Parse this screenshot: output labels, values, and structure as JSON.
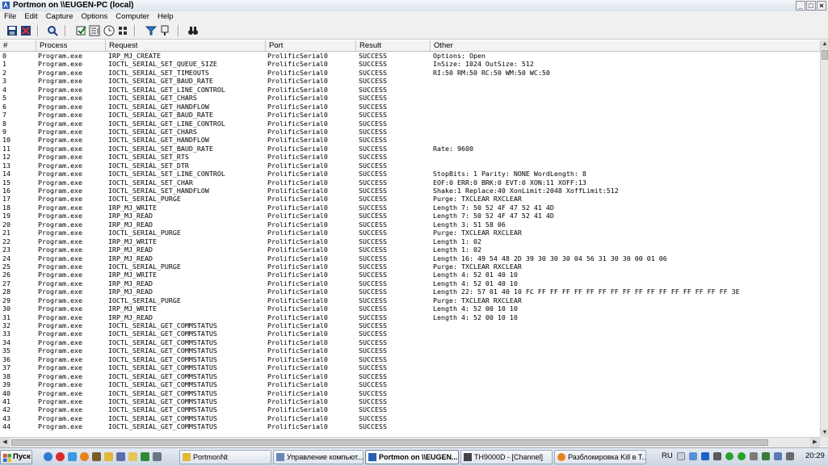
{
  "window": {
    "title": "Portmon on \\\\EUGEN-PC (local)"
  },
  "menu": [
    "File",
    "Edit",
    "Capture",
    "Options",
    "Computer",
    "Help"
  ],
  "columns": [
    "#",
    "Process",
    "Request",
    "Port",
    "Result",
    "Other"
  ],
  "rows": [
    [
      "0",
      "Program.exe",
      "IRP_MJ_CREATE",
      "ProlificSerial0",
      "SUCCESS",
      "Options: Open"
    ],
    [
      "1",
      "Program.exe",
      "IOCTL_SERIAL_SET_QUEUE_SIZE",
      "ProlificSerial0",
      "SUCCESS",
      "InSize: 1024 OutSize: 512"
    ],
    [
      "2",
      "Program.exe",
      "IOCTL_SERIAL_SET_TIMEOUTS",
      "ProlificSerial0",
      "SUCCESS",
      "RI:50 RM:50 RC:50 WM:50 WC:50"
    ],
    [
      "3",
      "Program.exe",
      "IOCTL_SERIAL_GET_BAUD_RATE",
      "ProlificSerial0",
      "SUCCESS",
      ""
    ],
    [
      "4",
      "Program.exe",
      "IOCTL_SERIAL_GET_LINE_CONTROL",
      "ProlificSerial0",
      "SUCCESS",
      ""
    ],
    [
      "5",
      "Program.exe",
      "IOCTL_SERIAL_GET_CHARS",
      "ProlificSerial0",
      "SUCCESS",
      ""
    ],
    [
      "6",
      "Program.exe",
      "IOCTL_SERIAL_GET_HANDFLOW",
      "ProlificSerial0",
      "SUCCESS",
      ""
    ],
    [
      "7",
      "Program.exe",
      "IOCTL_SERIAL_GET_BAUD_RATE",
      "ProlificSerial0",
      "SUCCESS",
      ""
    ],
    [
      "8",
      "Program.exe",
      "IOCTL_SERIAL_GET_LINE_CONTROL",
      "ProlificSerial0",
      "SUCCESS",
      ""
    ],
    [
      "9",
      "Program.exe",
      "IOCTL_SERIAL_GET_CHARS",
      "ProlificSerial0",
      "SUCCESS",
      ""
    ],
    [
      "10",
      "Program.exe",
      "IOCTL_SERIAL_GET_HANDFLOW",
      "ProlificSerial0",
      "SUCCESS",
      ""
    ],
    [
      "11",
      "Program.exe",
      "IOCTL_SERIAL_SET_BAUD_RATE",
      "ProlificSerial0",
      "SUCCESS",
      "Rate: 9600"
    ],
    [
      "12",
      "Program.exe",
      "IOCTL_SERIAL_SET_RTS",
      "ProlificSerial0",
      "SUCCESS",
      ""
    ],
    [
      "13",
      "Program.exe",
      "IOCTL_SERIAL_SET_DTR",
      "ProlificSerial0",
      "SUCCESS",
      ""
    ],
    [
      "14",
      "Program.exe",
      "IOCTL_SERIAL_SET_LINE_CONTROL",
      "ProlificSerial0",
      "SUCCESS",
      "StopBits: 1 Parity: NONE WordLength: 8"
    ],
    [
      "15",
      "Program.exe",
      "IOCTL_SERIAL_SET_CHAR",
      "ProlificSerial0",
      "SUCCESS",
      "EOF:0 ERR:0 BRK:0 EVT:0 XON:11 XOFF:13"
    ],
    [
      "16",
      "Program.exe",
      "IOCTL_SERIAL_SET_HANDFLOW",
      "ProlificSerial0",
      "SUCCESS",
      "Shake:1 Replace:40 XonLimit:2048 XoffLimit:512"
    ],
    [
      "17",
      "Program.exe",
      "IOCTL_SERIAL_PURGE",
      "ProlificSerial0",
      "SUCCESS",
      "Purge: TXCLEAR RXCLEAR"
    ],
    [
      "18",
      "Program.exe",
      "IRP_MJ_WRITE",
      "ProlificSerial0",
      "SUCCESS",
      "Length 7: 50 52 4F 47 52 41 4D"
    ],
    [
      "19",
      "Program.exe",
      "IRP_MJ_READ",
      "ProlificSerial0",
      "SUCCESS",
      "Length 7: 50 52 4F 47 52 41 4D"
    ],
    [
      "20",
      "Program.exe",
      "IRP_MJ_READ",
      "ProlificSerial0",
      "SUCCESS",
      "Length 3: 51 58 06"
    ],
    [
      "21",
      "Program.exe",
      "IOCTL_SERIAL_PURGE",
      "ProlificSerial0",
      "SUCCESS",
      "Purge: TXCLEAR RXCLEAR"
    ],
    [
      "22",
      "Program.exe",
      "IRP_MJ_WRITE",
      "ProlificSerial0",
      "SUCCESS",
      "Length 1: 02"
    ],
    [
      "23",
      "Program.exe",
      "IRP_MJ_READ",
      "ProlificSerial0",
      "SUCCESS",
      "Length 1: 02"
    ],
    [
      "24",
      "Program.exe",
      "IRP_MJ_READ",
      "ProlificSerial0",
      "SUCCESS",
      "Length 16: 49 54 48 2D 39 30 30 30 04 56 31 30 30 00 01 06"
    ],
    [
      "25",
      "Program.exe",
      "IOCTL_SERIAL_PURGE",
      "ProlificSerial0",
      "SUCCESS",
      "Purge: TXCLEAR RXCLEAR"
    ],
    [
      "26",
      "Program.exe",
      "IRP_MJ_WRITE",
      "ProlificSerial0",
      "SUCCESS",
      "Length 4: 52 01 40 10"
    ],
    [
      "27",
      "Program.exe",
      "IRP_MJ_READ",
      "ProlificSerial0",
      "SUCCESS",
      "Length 4: 52 01 40 10"
    ],
    [
      "28",
      "Program.exe",
      "IRP_MJ_READ",
      "ProlificSerial0",
      "SUCCESS",
      "Length 22: 57 01 40 10 FC FF FF FF FF FF FF FF FF FF FF FF FF FF FF FF FF 3E"
    ],
    [
      "29",
      "Program.exe",
      "IOCTL_SERIAL_PURGE",
      "ProlificSerial0",
      "SUCCESS",
      "Purge: TXCLEAR RXCLEAR"
    ],
    [
      "30",
      "Program.exe",
      "IRP_MJ_WRITE",
      "ProlificSerial0",
      "SUCCESS",
      "Length 4: 52 00 10 10"
    ],
    [
      "31",
      "Program.exe",
      "IRP_MJ_READ",
      "ProlificSerial0",
      "SUCCESS",
      "Length 4: 52 00 10 10"
    ],
    [
      "32",
      "Program.exe",
      "IOCTL_SERIAL_GET_COMMSTATUS",
      "ProlificSerial0",
      "SUCCESS",
      ""
    ],
    [
      "33",
      "Program.exe",
      "IOCTL_SERIAL_GET_COMMSTATUS",
      "ProlificSerial0",
      "SUCCESS",
      ""
    ],
    [
      "34",
      "Program.exe",
      "IOCTL_SERIAL_GET_COMMSTATUS",
      "ProlificSerial0",
      "SUCCESS",
      ""
    ],
    [
      "35",
      "Program.exe",
      "IOCTL_SERIAL_GET_COMMSTATUS",
      "ProlificSerial0",
      "SUCCESS",
      ""
    ],
    [
      "36",
      "Program.exe",
      "IOCTL_SERIAL_GET_COMMSTATUS",
      "ProlificSerial0",
      "SUCCESS",
      ""
    ],
    [
      "37",
      "Program.exe",
      "IOCTL_SERIAL_GET_COMMSTATUS",
      "ProlificSerial0",
      "SUCCESS",
      ""
    ],
    [
      "38",
      "Program.exe",
      "IOCTL_SERIAL_GET_COMMSTATUS",
      "ProlificSerial0",
      "SUCCESS",
      ""
    ],
    [
      "39",
      "Program.exe",
      "IOCTL_SERIAL_GET_COMMSTATUS",
      "ProlificSerial0",
      "SUCCESS",
      ""
    ],
    [
      "40",
      "Program.exe",
      "IOCTL_SERIAL_GET_COMMSTATUS",
      "ProlificSerial0",
      "SUCCESS",
      ""
    ],
    [
      "41",
      "Program.exe",
      "IOCTL_SERIAL_GET_COMMSTATUS",
      "ProlificSerial0",
      "SUCCESS",
      ""
    ],
    [
      "42",
      "Program.exe",
      "IOCTL_SERIAL_GET_COMMSTATUS",
      "ProlificSerial0",
      "SUCCESS",
      ""
    ],
    [
      "43",
      "Program.exe",
      "IOCTL_SERIAL_GET_COMMSTATUS",
      "ProlificSerial0",
      "SUCCESS",
      ""
    ],
    [
      "44",
      "Program.exe",
      "IOCTL_SERIAL_GET_COMMSTATUS",
      "ProlificSerial0",
      "SUCCESS",
      ""
    ]
  ],
  "taskbar": {
    "start_label": "Пуск",
    "tasks": [
      "PortmonNt",
      "Управление компьют...",
      "Portmon on \\\\EUGEN...",
      "TH9000D - [Channel]",
      "Разблокировка Kill в Т..."
    ],
    "language": "RU",
    "clock": "20:29"
  },
  "icons": {
    "toolbar": [
      "save-icon",
      "clear-icon",
      "find-icon",
      "capture-icon",
      "autoscroll-icon",
      "time-icon",
      "filter-icon",
      "highlight-icon",
      "history-icon",
      "binoculars-icon"
    ]
  }
}
